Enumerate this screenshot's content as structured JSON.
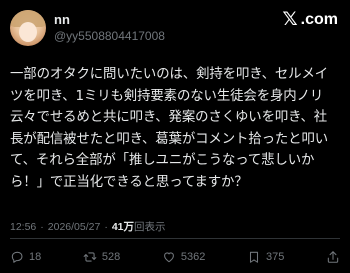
{
  "author": {
    "display_name": "nn",
    "handle": "@yy5508804417008",
    "avatar_icon": "avatar-icon"
  },
  "brand": {
    "logo_text": ".com",
    "logo_icon": "x-logo-icon"
  },
  "post": {
    "text": "一部のオタクに問いたいのは、剣持を叩き、セルメイツを叩き、1ミリも剣持要素のない生徒会を身内ノリ云々でせるめと共に叩き、発案のさくゆいを叩き、社長が配信被せたと叩き、葛葉がコメント拾ったと叩いて、それら全部が「推しユニがこうなって悲しいから！」で正当化できると思ってますか？"
  },
  "meta": {
    "time": "12:56",
    "separator": "·",
    "date": "2026/05/27",
    "views_count": "41万",
    "views_label": "回表示"
  },
  "stats": {
    "replies": "18",
    "reposts": "528",
    "likes": "5362",
    "bookmarks": "375"
  },
  "icons": [
    "reply-icon",
    "repost-icon",
    "like-icon",
    "bookmark-icon",
    "share-icon"
  ],
  "colors": {
    "background": "#000000",
    "text": "#e7e9ea",
    "muted": "#71767b",
    "divider": "#2f3336"
  }
}
